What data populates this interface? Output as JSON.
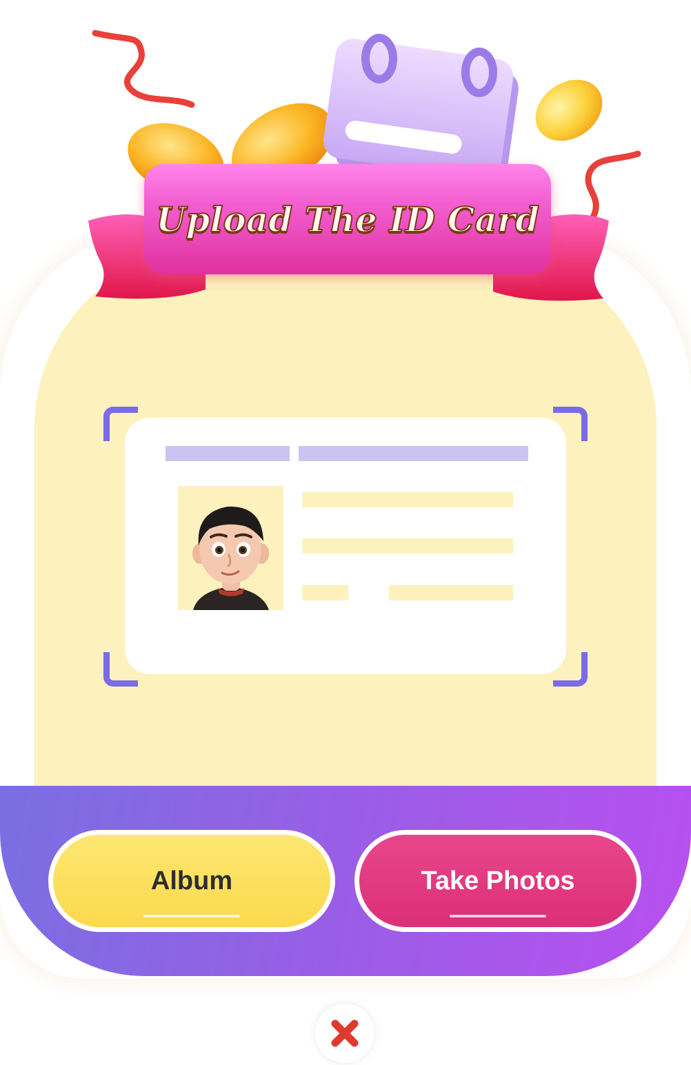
{
  "header": {
    "title": "Upload The ID Card"
  },
  "actions": {
    "album_label": "Album",
    "take_photos_label": "Take Photos"
  },
  "icons": {
    "calendar": "calendar-icon",
    "coin": "coin-icon",
    "ribbon": "ribbon-icon",
    "avatar": "avatar-illustration",
    "close": "close-icon"
  },
  "colors": {
    "card_background": "#fdf1bd",
    "panel_gradient_start": "#7a6fe2",
    "panel_gradient_end": "#b84ff0",
    "album_button": "#fcd94c",
    "take_photos_button": "#dc2f78",
    "title_banner": "#f35fd0",
    "frame_corners": "#7a6be6",
    "close_icon": "#e03a2f"
  }
}
